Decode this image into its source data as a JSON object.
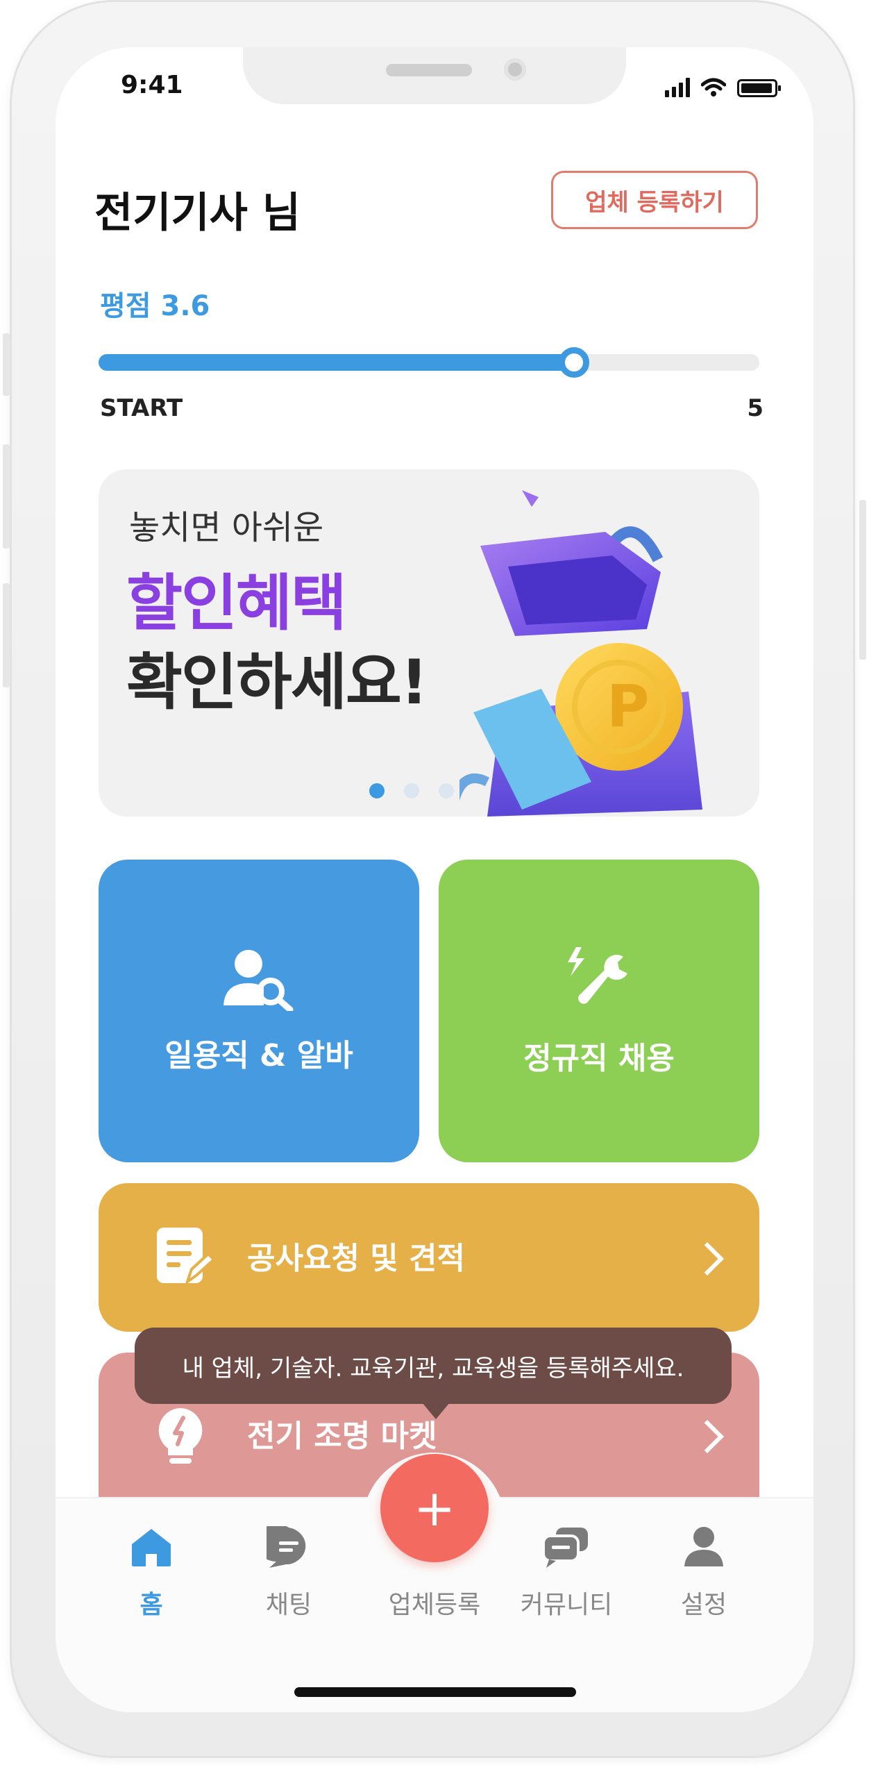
{
  "status_bar": {
    "time": "9:41"
  },
  "header": {
    "greeting": "전기기사 님",
    "register_button": "업체 등록하기"
  },
  "rating": {
    "label": "평점 3.6",
    "value": 3.6,
    "min_label": "START",
    "max_label": "5",
    "max": 5,
    "accent_color": "#3e9ae0"
  },
  "banner": {
    "subtitle": "놓치면 아쉬운",
    "title_line1": "할인혜택",
    "title_line2": "확인하세요!",
    "page_count": 3,
    "active_page": 1
  },
  "tiles": [
    {
      "label": "일용직 & 알바",
      "icon": "person-search-icon",
      "color": "#469be0"
    },
    {
      "label": "정규직 채용",
      "icon": "wrench-bolt-icon",
      "color": "#8dcf55"
    }
  ],
  "rows": [
    {
      "label": "공사요청 및 견적",
      "icon": "document-edit-icon",
      "color": "#e5b048"
    },
    {
      "label": "전기 조명 마켓",
      "icon": "lightbulb-icon",
      "color": "#de9896"
    }
  ],
  "tooltip": {
    "text": "내 업체, 기술자. 교육기관, 교육생을 등록해주세요."
  },
  "tabbar": {
    "items": [
      {
        "label": "홈",
        "icon": "home-icon",
        "active": true
      },
      {
        "label": "채팅",
        "icon": "chat-icon",
        "active": false
      },
      {
        "label": "업체등록",
        "icon": "plus-icon",
        "active": false
      },
      {
        "label": "커뮤니티",
        "icon": "community-icon",
        "active": false
      },
      {
        "label": "설정",
        "icon": "person-icon",
        "active": false
      }
    ],
    "fab_symbol": "+",
    "accent_color": "#f26a60"
  }
}
